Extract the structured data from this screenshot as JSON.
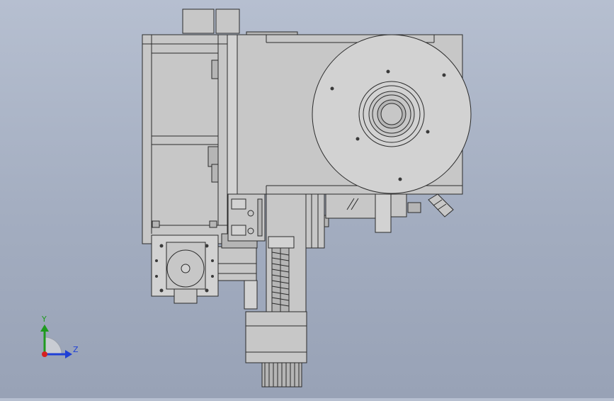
{
  "viewport": {
    "background_top": "#b6bfd0",
    "background_bottom": "#98a2b6",
    "part_fill": "#c7c7c7",
    "part_stroke": "#2b2b2b"
  },
  "triad": {
    "y_label": "Y",
    "z_label": "Z",
    "y_color": "#1f9a1f",
    "z_color": "#1f3fd6",
    "x_color": "#d62020"
  }
}
